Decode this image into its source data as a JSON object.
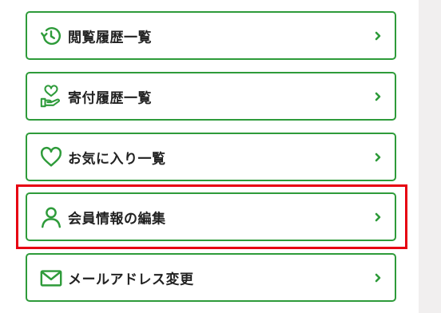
{
  "menu": {
    "items": [
      {
        "label": "閲覧履歴一覧",
        "icon": "history-icon"
      },
      {
        "label": "寄付履歴一覧",
        "icon": "donation-heart-hand-icon"
      },
      {
        "label": "お気に入り一覧",
        "icon": "heart-icon"
      },
      {
        "label": "会員情報の編集",
        "icon": "user-icon",
        "highlighted": true
      },
      {
        "label": "メールアドレス変更",
        "icon": "mail-icon"
      }
    ]
  },
  "colors": {
    "accent_green": "#2e9b3a",
    "highlight_red": "#e60012",
    "text": "#222222"
  }
}
